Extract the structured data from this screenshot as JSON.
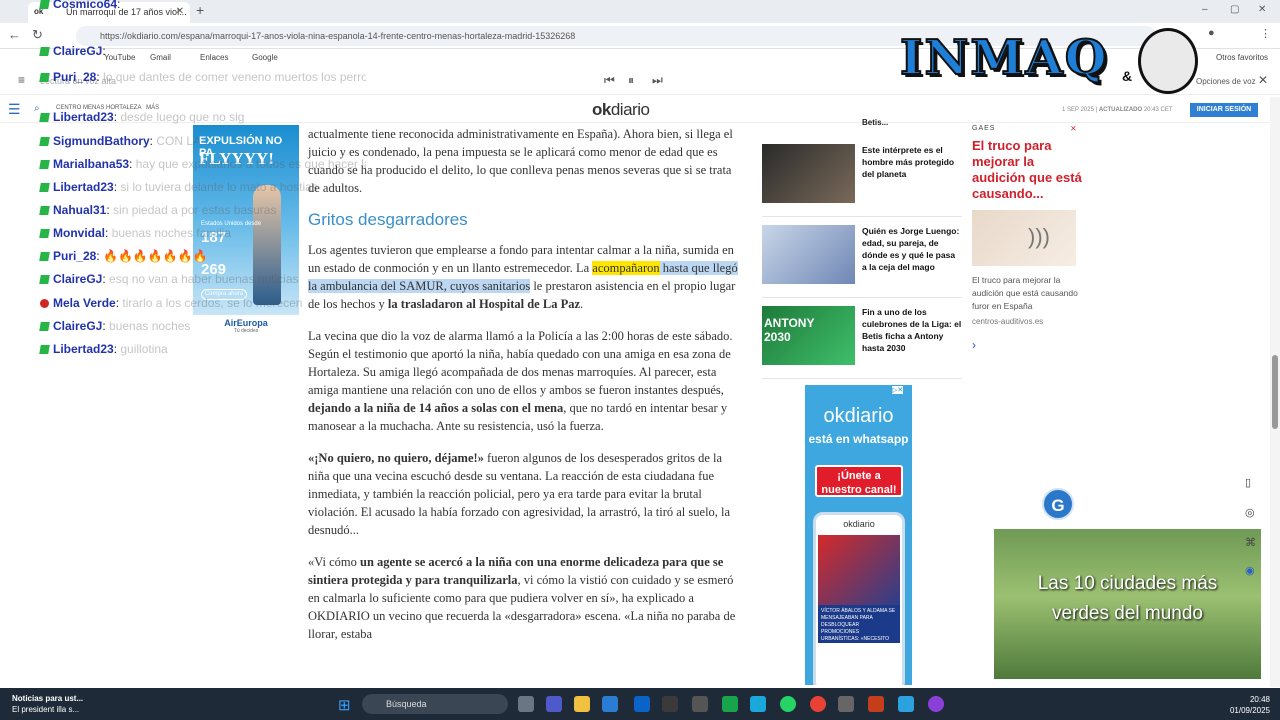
{
  "browser": {
    "tab_title": "Un marroquí de 17 años viol...",
    "tab_favicon": "ok",
    "url": "https://okdiario.com/espana/marroqui-17-anos-viola-nina-espanola-14-frente-centro-menas-hortaleza-madrid-15326268",
    "bookmarks": [
      "YouTube",
      "Gmail",
      "Enlaces",
      "Google"
    ],
    "other_bookmarks": "Otros favoritos",
    "read_aloud_label": "Lectura en voz alta",
    "voice_label": "Opciones de voz"
  },
  "site": {
    "logo_ok": "ok",
    "logo_diario": "diario",
    "section": "CENTRO MENAS HORTALEZA",
    "more": "MÁS",
    "date": "1 SEP 2025",
    "updated_label": "ACTUALIZADO",
    "updated_time": "20:43",
    "timezone": "CET",
    "login": "INICIAR SESIÓN"
  },
  "article": {
    "p0": "actualmente tiene reconocida administrativamente en España). Ahora bien, si llega el juicio y es condenado, la pena impuesta se le aplicará como menor de edad que es cuando se ha producido el delito, lo que conlleva penas menos severas que si se trata de adultos.",
    "heading": "Gritos desgarradores",
    "p1_a": "Los agentes tuvieron que emplearse a fondo para intentar calmar a la niña, sumida en un estado de conmoción y en un llanto estremecedor. La ",
    "p1_hl_yellow": "acompañaron",
    "p1_hl_blue": " hasta que llegó la ambulancia del SAMUR, cuyos sanitarios",
    "p1_b": " le prestaron asistencia en el propio lugar de los hechos y ",
    "p1_bold": "la trasladaron al Hospital de La Paz",
    "p1_end": ".",
    "p2_a": "La vecina que dio la voz de alarma llamó a la Policía a las 2:00 horas de este sábado. Según el testimonio que aportó la niña, había quedado con una amiga en esa zona de Hortaleza. Su amiga llegó acompañada de dos menas marroquíes. Al parecer, esta amiga mantiene una relación con uno de ellos y ambos se fueron instantes después, ",
    "p2_bold": "dejando a la niña de 14 años a solas con el mena",
    "p2_b": ", que no tardó en intentar besar y manosear a la muchacha. Ante su resistencia, usó la fuerza.",
    "p3_bold": "«¡No quiero, no quiero, déjame!»",
    "p3_a": " fueron algunos de los desesperados gritos de la niña que una vecina escuchó desde su ventana. La reacción de esta ciudadana fue inmediata, y también la reacción policial, pero ya era tarde para evitar la brutal violación. El acusado la había forzado con agresividad, la arrastró, la tiró al suelo, la desnudó...",
    "p4_a": "«Vi cómo ",
    "p4_bold1": "un agente se acercó a la niña con una enorme delicadeza para que se sintiera protegida y para tranquilizarla",
    "p4_b": ", vi cómo la vistió con cuidado y se esmeró en calmarla lo suficiente como para que pudiera volver en sí», ha explicado a OKDIARIO un vecino que recuerda la «desgarradora» escena. «La niña no paraba de llorar, estaba"
  },
  "sidebar": {
    "top_fragment": "Betis...",
    "items": [
      {
        "title": "Este intérprete es el hombre más protegido del planeta"
      },
      {
        "title": "Quién es Jorge Luengo: edad, su pareja, de dónde es y qué le pasa a la ceja del mago"
      },
      {
        "title": "Fin a uno de los culebrones de la Liga: el Betis ficha a Antony hasta 2030"
      }
    ],
    "antony_text": "ANTONY 2030"
  },
  "ad_right": {
    "label": "GAES",
    "title": "El truco para mejorar la audición que está causando...",
    "text": "El truco para mejorar la audición que está causando furor en España",
    "url": "centros-auditivos.es"
  },
  "wa_banner": {
    "logo": "okdiario",
    "sub": "está en whatsapp",
    "button": "¡Únete a nuestro canal!",
    "phone_logo": "okdiario",
    "phone_card": "VÍCTOR ÁBALOS Y ALDAMA SE MENSAJEABAN PARA DESBLOQUEAR PROMOCIONES URBANÍSTICAS: «NECESITO AYUDA»"
  },
  "video_ad": {
    "line1": "Las 10 ciudades más",
    "line2": "verdes del mundo",
    "badge": "G"
  },
  "air_ad": {
    "line1": "EXPULSIÓN NO PA",
    "line2": "FLYYYY!",
    "small": "Estados Unidos desde",
    "price1": "187",
    "price2": "269",
    "cta": "Compra ahora",
    "brand": "AirEuropa",
    "brand_sub": "Tú decides"
  },
  "chat": [
    {
      "user": "Cosmico64",
      "text": "",
      "badge": "green"
    },
    {
      "user": "ClaireGJ",
      "text": "",
      "badge": "green"
    },
    {
      "user": "Puri_28",
      "text": "lo que dantes de comer veneno muertos los perros se terminan las",
      "badge": "green"
    },
    {
      "user": "Libertad23",
      "text": "desde luego que no sig",
      "badge": "green"
    },
    {
      "user": "SigmundBathory",
      "text": "CON LA ...",
      "badge": "green"
    },
    {
      "user": "Marialbana53",
      "text": "hay que expulsarlos a todos es que hacer las gestión",
      "badge": "green"
    },
    {
      "user": "Libertad23",
      "text": "si lo tuviera delante lo mato a hostias",
      "badge": "green"
    },
    {
      "user": "Nahual31",
      "text": "sin piedad a por estas basuras",
      "badge": "green"
    },
    {
      "user": "Monvidal",
      "text": "buenas noches familia",
      "badge": "green"
    },
    {
      "user": "Puri_28",
      "text": "",
      "badge": "green"
    },
    {
      "user": "ClaireGJ",
      "text": "esq no van a haber buenas noticias",
      "badge": "green"
    },
    {
      "user": "Mela Verde",
      "text": "tirarlo a los cerdos, se lo merecen",
      "badge": "red"
    },
    {
      "user": "ClaireGJ",
      "text": "buenas noches",
      "badge": "green"
    },
    {
      "user": "Libertad23",
      "text": "guillotina",
      "badge": "green"
    }
  ],
  "chat_emotes": "🔥🔥🔥🔥🔥🔥🔥",
  "brand_logo": {
    "text": "INMAQ",
    "amp": "&"
  },
  "taskbar": {
    "news_title": "Noticias para ust...",
    "news_sub": "El president illa s...",
    "search": "Búsqueda",
    "time": "20:48",
    "date": "01/09/2025"
  },
  "colors": {
    "ok_blue": "#3a8fc9",
    "login_blue": "#2f7fd3",
    "ad_red": "#d0202c",
    "chat_user": "#2233aa"
  }
}
